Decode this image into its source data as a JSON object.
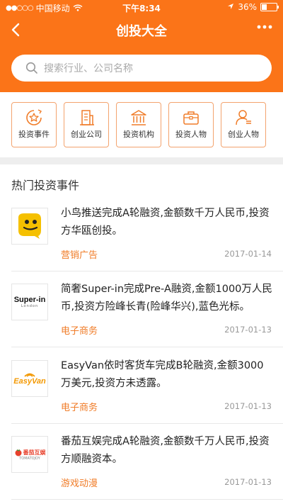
{
  "status": {
    "carrier": "中国移动",
    "time": "下午8:34",
    "battery": "36%"
  },
  "nav": {
    "title": "创投大全"
  },
  "search": {
    "placeholder": "搜索行业、公司名称"
  },
  "categories": [
    {
      "label": "投资事件",
      "icon": "investment-event-icon"
    },
    {
      "label": "创业公司",
      "icon": "startup-building-icon"
    },
    {
      "label": "投资机构",
      "icon": "institution-icon"
    },
    {
      "label": "投资人物",
      "icon": "briefcase-icon"
    },
    {
      "label": "创业人物",
      "icon": "person-icon"
    }
  ],
  "section_title": "热门投资事件",
  "events": [
    {
      "text": "小鸟推送完成A轮融资,金额数千万人民币,投资方华瓯创投。",
      "tag": "营销广告",
      "date": "2017-01-14",
      "logo": "bird-logo"
    },
    {
      "text": "简奢Super-in完成Pre-A融资,金额1000万人民币,投资方险峰长青(险峰华兴),蓝色光标。",
      "tag": "电子商务",
      "date": "2017-01-13",
      "logo": "Super-in",
      "logo_sub": "London"
    },
    {
      "text": "EasyVan依时客货车完成B轮融资,金额3000万美元,投资方未透露。",
      "tag": "电子商务",
      "date": "2017-01-13",
      "logo": "EasyVan"
    },
    {
      "text": "番茄互娱完成A轮融资,金额数千万人民币,投资方顺融资本。",
      "tag": "游戏动漫",
      "date": "2017-01-13",
      "logo": "番茄互娱",
      "logo_sub": "TOMATOJOY"
    }
  ]
}
